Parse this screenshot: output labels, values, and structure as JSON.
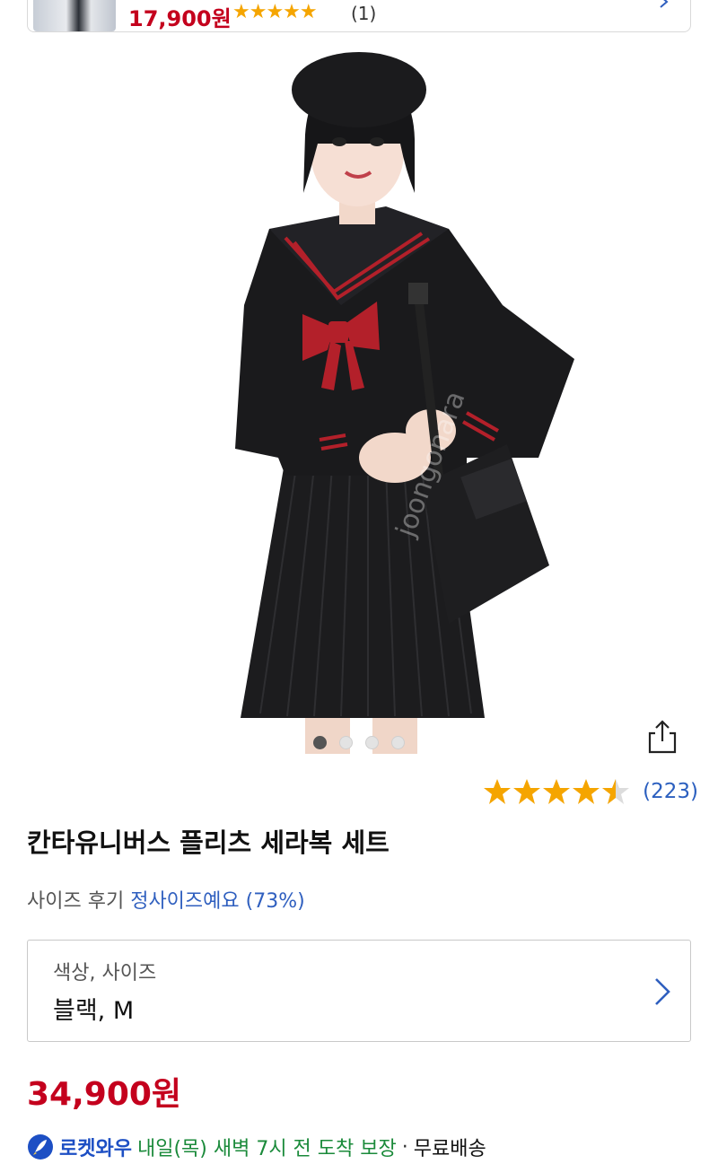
{
  "top_card": {
    "price": "17,900원",
    "stars": "★★★★★",
    "review_count": "(1)"
  },
  "hero": {
    "image_alt": "Black sailor uniform set with red bow",
    "watermark": "joongonara",
    "dot_count": 4,
    "active_dot": 0
  },
  "rating": {
    "value": 4.5,
    "count": "(223)"
  },
  "product": {
    "title": "칸타유니버스 플리츠 세라복 세트",
    "size_review_label": "사이즈 후기",
    "size_review_value": "정사이즈예요 (73%)"
  },
  "option": {
    "label": "색상, 사이즈",
    "value": "블랙, M"
  },
  "price": "34,900원",
  "delivery": {
    "brand": "로켓와우",
    "eta": "내일(목) 새벽 7시 전 도착 보장",
    "separator": "·",
    "shipping": "무료배송"
  },
  "colors": {
    "price_red": "#c4001d",
    "link_blue": "#2f5fbf",
    "star_gold": "#f5a500",
    "eta_green": "#1a8a3a"
  }
}
